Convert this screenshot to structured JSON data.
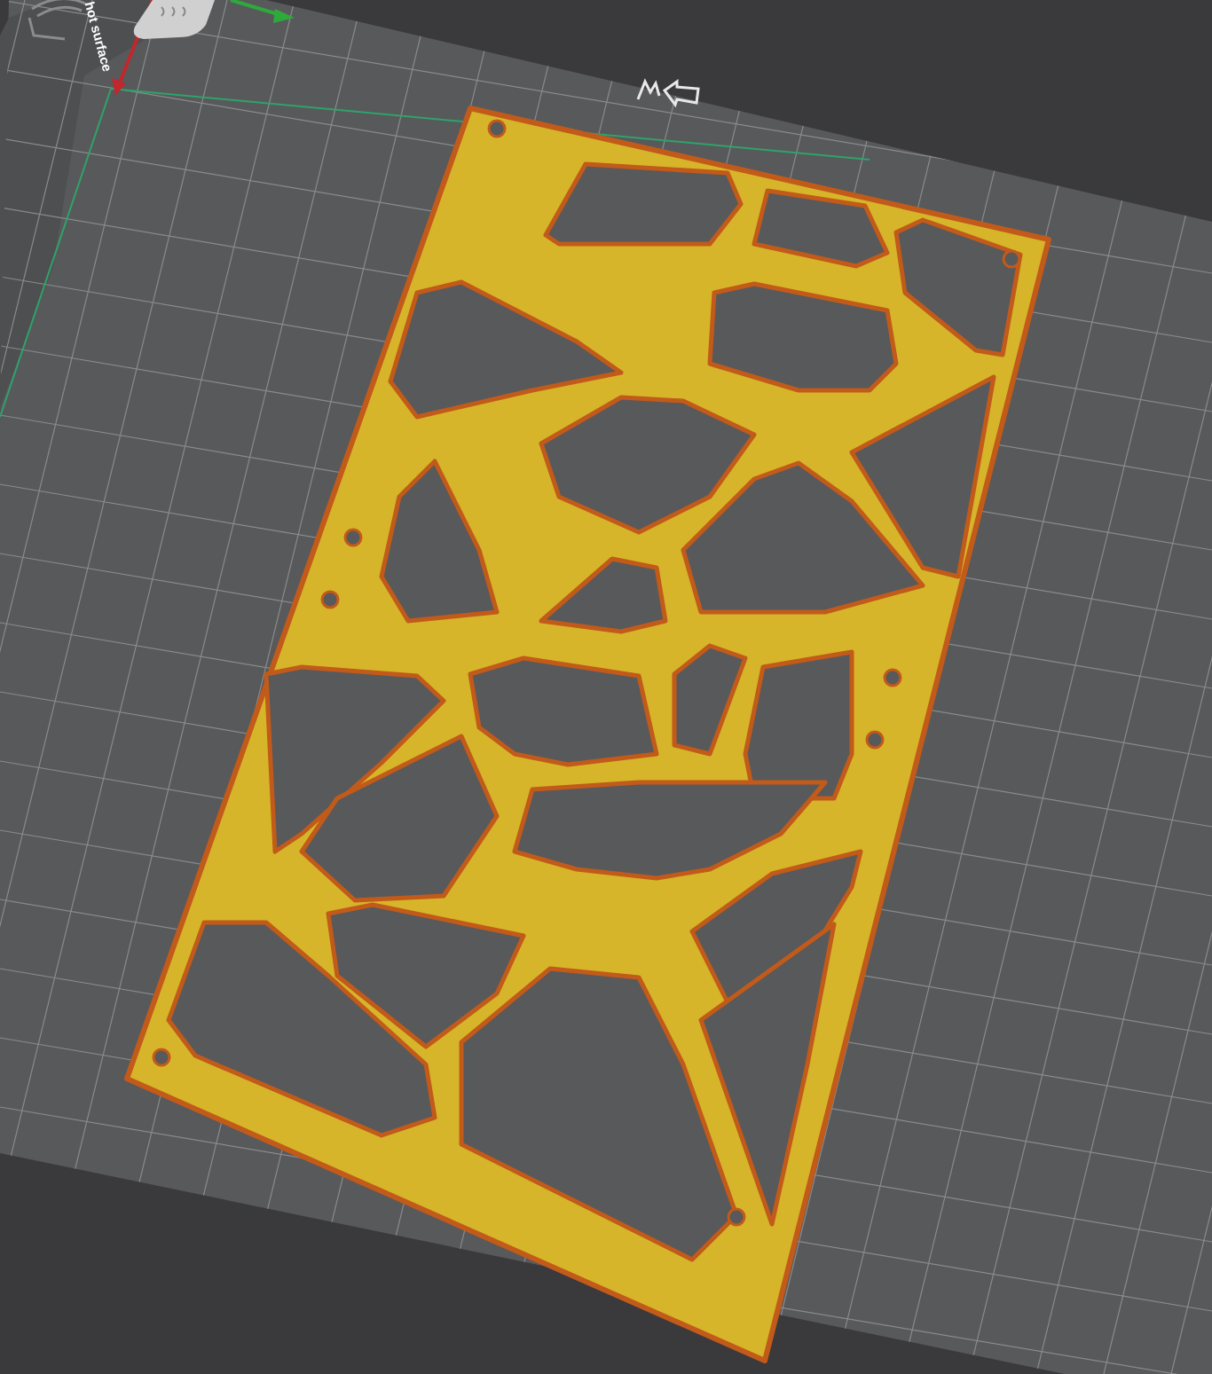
{
  "bed": {
    "label": "hot surface"
  }
}
